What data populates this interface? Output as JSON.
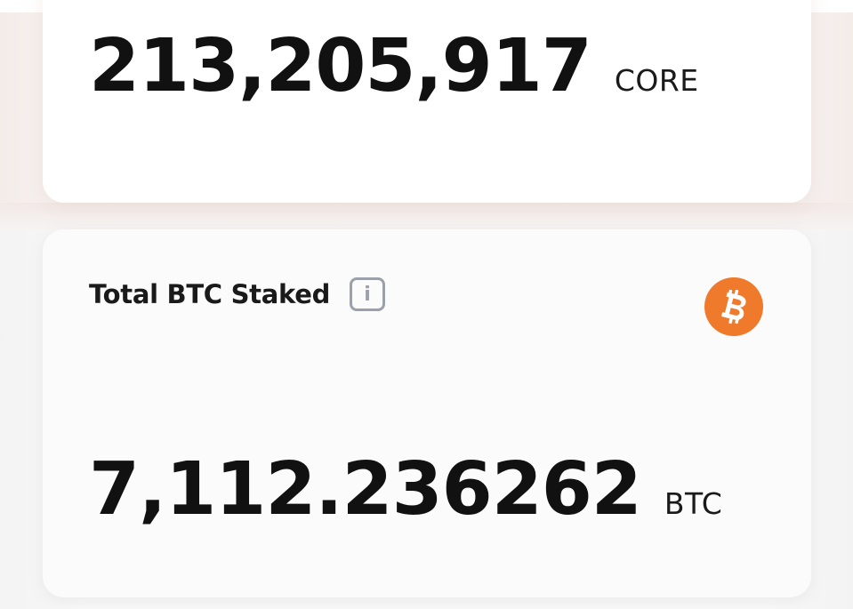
{
  "core_card": {
    "value": "213,205,917",
    "unit": "CORE"
  },
  "btc_card": {
    "title": "Total BTC Staked",
    "info_icon": "info-icon",
    "logo_icon": "bitcoin-logo-icon",
    "logo_color": "#f07a2c",
    "value": "7,112.236262",
    "unit": "BTC"
  }
}
